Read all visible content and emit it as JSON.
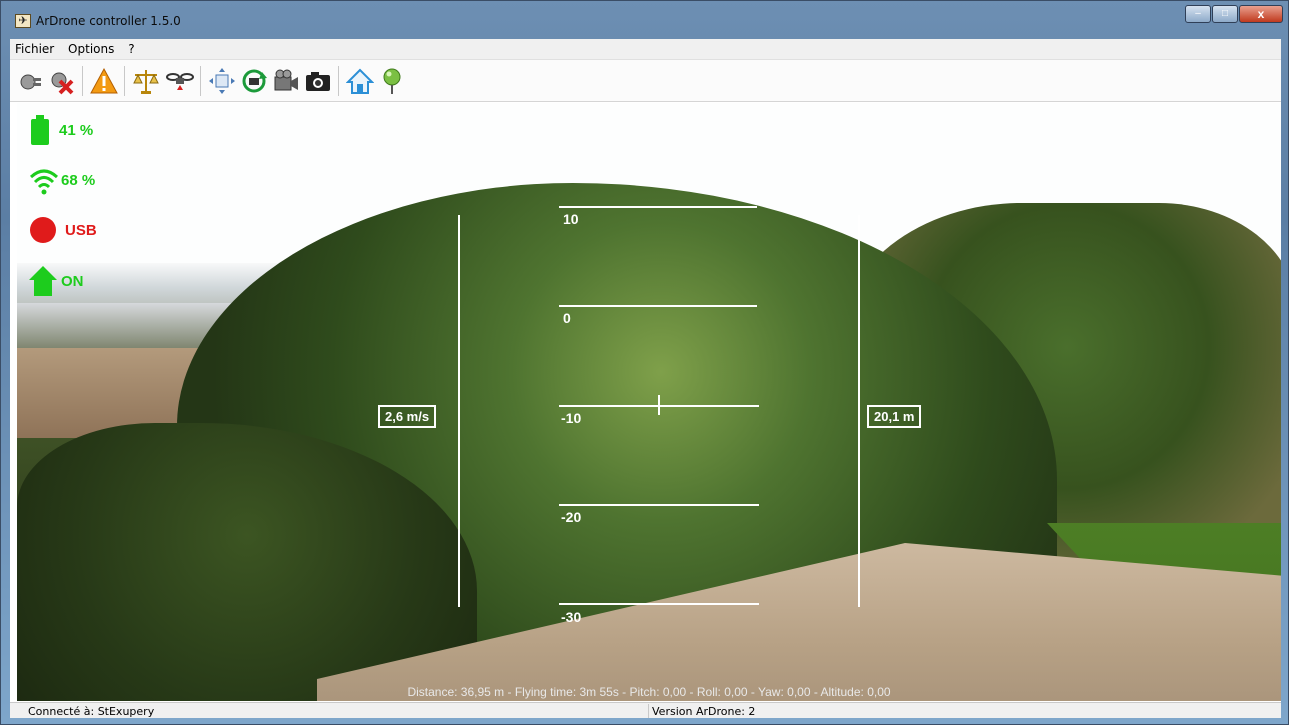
{
  "window": {
    "title": "ArDrone controller 1.5.0",
    "minimize": "–",
    "maximize": "□",
    "close": "x"
  },
  "menu": {
    "items": [
      "Fichier",
      "Options",
      "?"
    ]
  },
  "toolbar": {
    "icons": [
      "connect-icon",
      "disconnect-icon",
      "emergency-icon",
      "trim-icon",
      "drone-icon",
      "resize-icon",
      "rotate-camera-icon",
      "video-camera-icon",
      "photo-camera-icon",
      "home-icon",
      "map-pin-icon"
    ]
  },
  "hud": {
    "battery": "41 %",
    "wifi": "68 %",
    "usb": "USB",
    "home": "ON",
    "pitch_ladder": [
      "10",
      "0",
      "-10",
      "-20",
      "-30"
    ],
    "speed": "2,6 m/s",
    "altitude": "20,1 m",
    "info": "Distance: 36,95 m - Flying time: 3m 55s - Pitch: 0,00 - Roll: 0,00 - Yaw: 0,00 - Altitude: 0,00",
    "colors": {
      "ok": "#1dcc1d",
      "alert": "#e01b1b",
      "overlay": "#ffffff"
    }
  },
  "status": {
    "connection": "Connecté à: StExupery",
    "version": "Version ArDrone: 2"
  }
}
